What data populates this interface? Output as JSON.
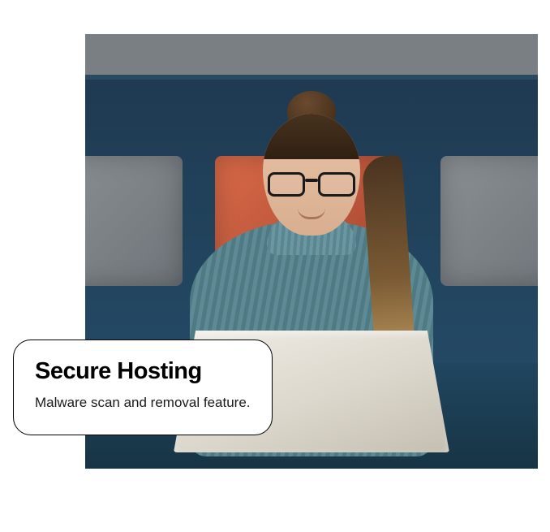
{
  "card": {
    "title": "Secure Hosting",
    "description": "Malware scan and removal feature."
  },
  "image": {
    "alt": "Person wearing glasses and a teal ribbed sweater sitting on a blue sofa with grey and orange pillows, smiling while using a laptop"
  }
}
